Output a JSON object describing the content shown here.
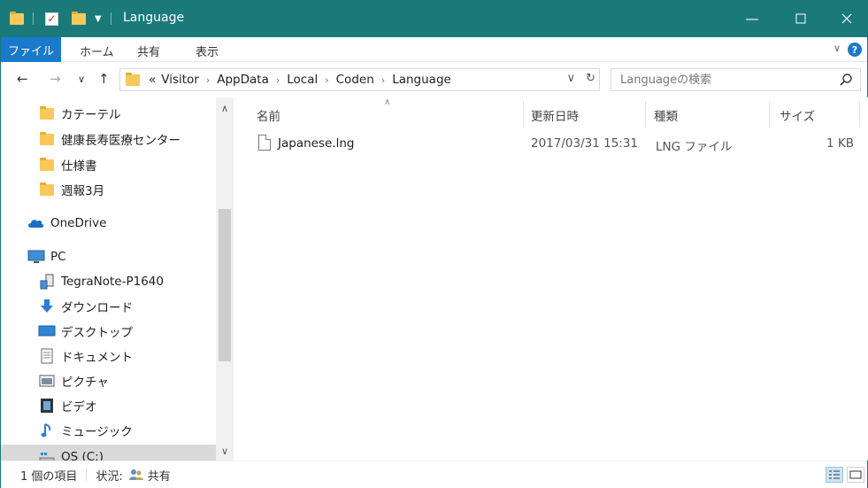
{
  "window": {
    "title": "Language"
  },
  "ribbon": {
    "file": "ファイル",
    "tabs": [
      "ホーム",
      "共有",
      "表示"
    ],
    "help": "?"
  },
  "address": {
    "prefix": "«",
    "crumbs": [
      "Visitor",
      "AppData",
      "Local",
      "Coden",
      "Language"
    ],
    "search_placeholder": "Languageの検索"
  },
  "navpane": {
    "items": [
      {
        "label": "カテーテル",
        "icon": "folder-icon"
      },
      {
        "label": "健康長寿医療センター",
        "icon": "folder-icon"
      },
      {
        "label": "仕様書",
        "icon": "folder-icon"
      },
      {
        "label": "週報3月",
        "icon": "folder-icon"
      },
      {
        "label": "OneDrive",
        "icon": "cloud-icon"
      },
      {
        "label": "PC",
        "icon": "pc-icon"
      },
      {
        "label": "TegraNote-P1640",
        "icon": "device-icon"
      },
      {
        "label": "ダウンロード",
        "icon": "download-icon"
      },
      {
        "label": "デスクトップ",
        "icon": "desktop-icon"
      },
      {
        "label": "ドキュメント",
        "icon": "documents-icon"
      },
      {
        "label": "ピクチャ",
        "icon": "pictures-icon"
      },
      {
        "label": "ビデオ",
        "icon": "video-icon"
      },
      {
        "label": "ミュージック",
        "icon": "music-icon"
      },
      {
        "label": "OS (C:)",
        "icon": "drive-icon"
      }
    ]
  },
  "content": {
    "columns": {
      "name": "名前",
      "date": "更新日時",
      "type": "種類",
      "size": "サイズ"
    },
    "files": [
      {
        "name": "Japanese.lng",
        "date": "2017/03/31 15:31",
        "type": "LNG ファイル",
        "size": "1 KB"
      }
    ]
  },
  "status": {
    "count": "1 個の項目",
    "state_label": "状況:",
    "state_value": "共有"
  },
  "colors": {
    "titlebar": "#1a7a7a",
    "file_tab": "#1979ca",
    "folder": "#f6c95a"
  }
}
